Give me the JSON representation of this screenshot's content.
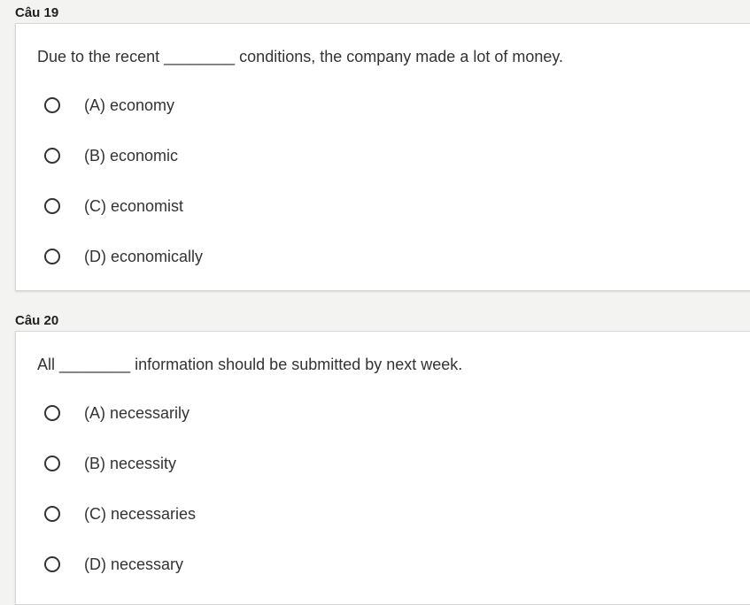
{
  "questions": [
    {
      "label": "Câu 19",
      "text": "Due to the recent ________ conditions, the company made a lot of money.",
      "options": [
        {
          "label": "(A) economy"
        },
        {
          "label": "(B) economic"
        },
        {
          "label": "(C) economist"
        },
        {
          "label": "(D) economically"
        }
      ]
    },
    {
      "label": "Câu 20",
      "text": "All ________ information should be submitted by next week.",
      "options": [
        {
          "label": "(A) necessarily"
        },
        {
          "label": "(B) necessity"
        },
        {
          "label": "(C) necessaries"
        },
        {
          "label": "(D) necessary"
        }
      ]
    }
  ]
}
